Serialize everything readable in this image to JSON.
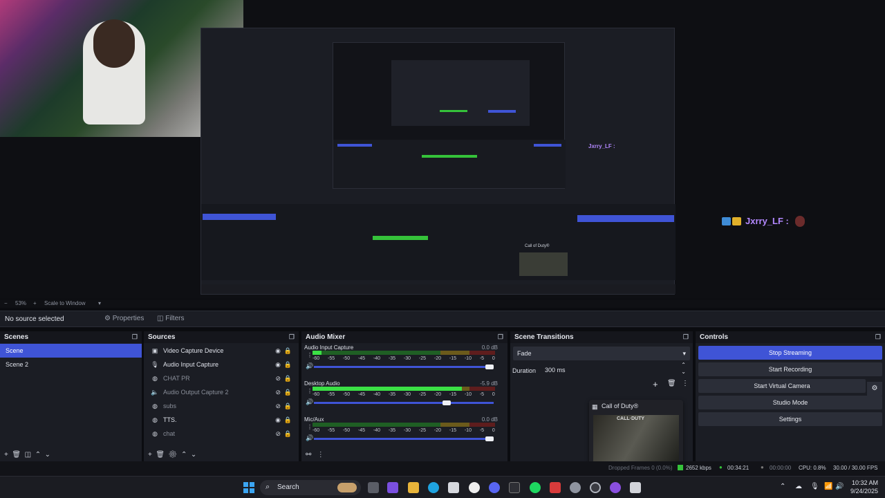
{
  "window": {
    "controls": [
      "–",
      "☐",
      "✕"
    ]
  },
  "preview": {
    "chat_overlay": {
      "user": "Jxrry_LF :",
      "icon": "Jxrry_LF"
    },
    "nested_chat": "Jxrry_LF :",
    "nested_scene": "Call of Duty®"
  },
  "scalebar": {
    "zoom": "53%",
    "mode": "Scale to Window"
  },
  "source_toolbar": {
    "status": "No source selected",
    "properties": "Properties",
    "filters": "Filters"
  },
  "scenes": {
    "title": "Scenes",
    "items": [
      {
        "label": "Scene",
        "selected": true
      },
      {
        "label": "Scene 2",
        "selected": false
      }
    ]
  },
  "sources": {
    "title": "Sources",
    "items": [
      {
        "label": "Video Capture Device",
        "icon": "camera-icon",
        "visible": true
      },
      {
        "label": "Audio Input Capture",
        "icon": "microphone-icon",
        "visible": true
      },
      {
        "label": "CHAT PR",
        "icon": "globe-icon",
        "visible": false
      },
      {
        "label": "Audio Output Capture 2",
        "icon": "speaker-icon",
        "visible": false
      },
      {
        "label": "subs",
        "icon": "globe-icon",
        "visible": false
      },
      {
        "label": "TTS.",
        "icon": "globe-icon",
        "visible": true
      },
      {
        "label": "chat",
        "icon": "globe-icon",
        "visible": false
      }
    ]
  },
  "mixer": {
    "title": "Audio Mixer",
    "channels": [
      {
        "name": "Audio Input Capture",
        "db": "0.0 dB",
        "level": 0.05,
        "volume": 1.0
      },
      {
        "name": "Desktop Audio",
        "db": "-5.9 dB",
        "level": 0.82,
        "volume": 0.75
      },
      {
        "name": "Mic/Aux",
        "db": "0.0 dB",
        "level": 0.0,
        "volume": 1.0
      }
    ],
    "ticks": [
      "-60",
      "-55",
      "-50",
      "-45",
      "-40",
      "-35",
      "-30",
      "-25",
      "-20",
      "-15",
      "-10",
      "-5",
      "0"
    ]
  },
  "transitions": {
    "title": "Scene Transitions",
    "selected": "Fade",
    "duration_label": "Duration",
    "duration_value": "300 ms"
  },
  "controls": {
    "title": "Controls",
    "stop_streaming": "Stop Streaming",
    "start_recording": "Start Recording",
    "start_virtual_camera": "Start Virtual Camera",
    "studio_mode": "Studio Mode",
    "settings": "Settings"
  },
  "game_popup": {
    "title": "Call of Duty®",
    "art_text": "CALL·DUTY"
  },
  "status": {
    "bitrate": "2652 kbps",
    "stream_time": "00:34:21",
    "record_time": "00:00:00",
    "cpu": "CPU: 0.8%",
    "fps": "30.00 / 30.00 FPS",
    "dropped": "Dropped Frames 0 (0.0%)"
  },
  "taskbar": {
    "search": "Search",
    "time": "10:32 AM",
    "date": "9/24/2025"
  },
  "colors": {
    "accent": "#3f54d6",
    "meter_green": "#3be045",
    "stream_green": "#35c23a"
  }
}
